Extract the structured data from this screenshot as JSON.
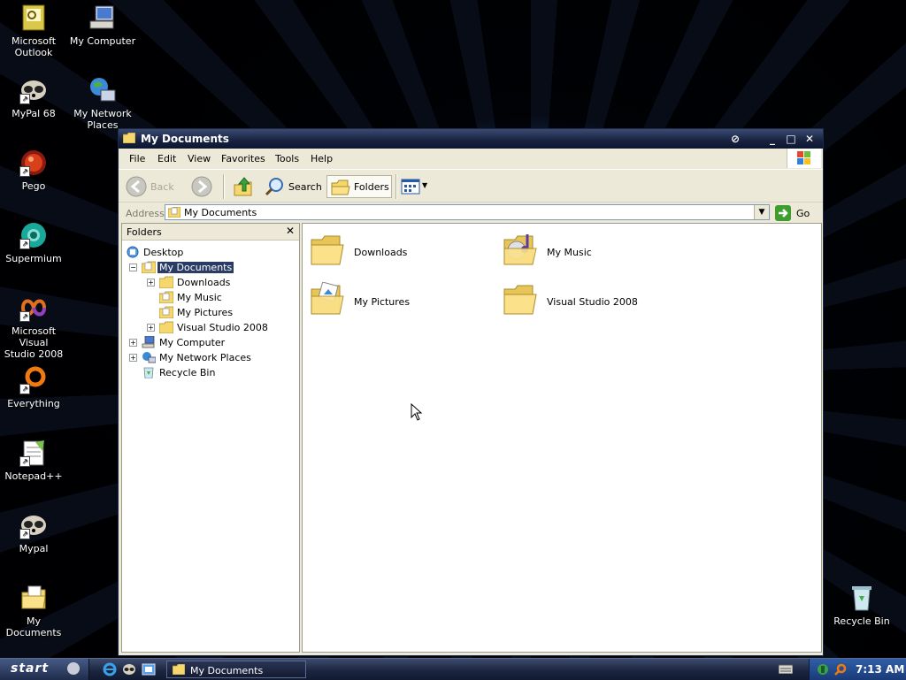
{
  "desktop": {
    "icons_left": [
      {
        "label": "Microsoft\nOutlook",
        "icon": "outlook-icon"
      },
      {
        "label": "MyPal 68",
        "icon": "mypal-icon"
      },
      {
        "label": "Pego",
        "icon": "pego-icon"
      },
      {
        "label": "Supermium",
        "icon": "supermium-icon"
      },
      {
        "label": "Microsoft Visual\nStudio 2008",
        "icon": "visual-studio-icon"
      },
      {
        "label": "Everything",
        "icon": "everything-icon"
      },
      {
        "label": "Notepad++",
        "icon": "notepad-plus-plus-icon"
      },
      {
        "label": "Mypal",
        "icon": "mypal-icon"
      },
      {
        "label": "My Documents",
        "icon": "my-documents-icon"
      }
    ],
    "icons_col2": [
      {
        "label": "My Computer",
        "icon": "my-computer-icon"
      },
      {
        "label": "My Network\nPlaces",
        "icon": "network-places-icon"
      }
    ],
    "recycle_bin": {
      "label": "Recycle Bin",
      "icon": "recycle-bin-icon"
    }
  },
  "window": {
    "title": "My Documents",
    "menu": [
      "File",
      "Edit",
      "View",
      "Favorites",
      "Tools",
      "Help"
    ],
    "toolbar": {
      "back_label": "Back",
      "search_label": "Search",
      "folders_label": "Folders"
    },
    "address": {
      "label": "Address",
      "value": "My Documents",
      "go_label": "Go"
    },
    "folders_pane": {
      "title": "Folders",
      "close_glyph": "✕",
      "tree": [
        {
          "label": "Desktop",
          "indent": 0,
          "expander": "",
          "selected": false
        },
        {
          "label": "My Documents",
          "indent": 1,
          "expander": "−",
          "selected": true
        },
        {
          "label": "Downloads",
          "indent": 2,
          "expander": "+",
          "selected": false
        },
        {
          "label": "My Music",
          "indent": 2,
          "expander": "",
          "selected": false
        },
        {
          "label": "My Pictures",
          "indent": 2,
          "expander": "",
          "selected": false
        },
        {
          "label": "Visual Studio 2008",
          "indent": 2,
          "expander": "+",
          "selected": false
        },
        {
          "label": "My Computer",
          "indent": 1,
          "expander": "+",
          "selected": false
        },
        {
          "label": "My Network Places",
          "indent": 1,
          "expander": "+",
          "selected": false
        },
        {
          "label": "Recycle Bin",
          "indent": 1,
          "expander": "",
          "selected": false
        }
      ]
    },
    "items": [
      {
        "label": "Downloads",
        "icon": "folder-icon"
      },
      {
        "label": "My Music",
        "icon": "music-folder-icon"
      },
      {
        "label": "My Pictures",
        "icon": "pictures-folder-icon"
      },
      {
        "label": "Visual Studio 2008",
        "icon": "folder-icon"
      }
    ]
  },
  "taskbar": {
    "start_label": "start",
    "task_button_label": "My Documents",
    "clock": "7:13 AM"
  },
  "colors": {
    "title_bar": "#17223f",
    "selection": "#2a3b66",
    "folder_yellow": "#f5d76e",
    "tray_blue": "#2f5fa7"
  }
}
